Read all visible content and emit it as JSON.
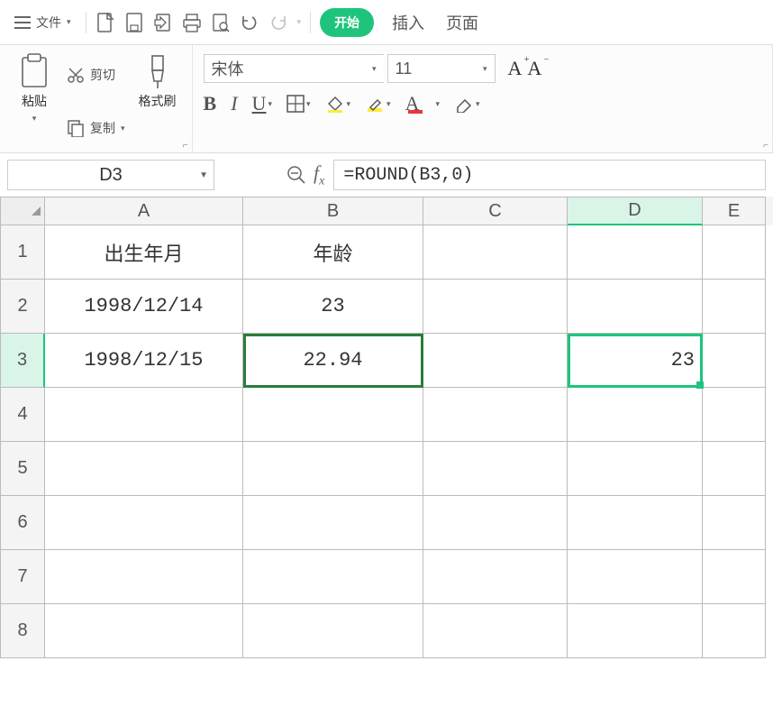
{
  "menu": {
    "file": "文件",
    "start": "开始",
    "insert": "插入",
    "pagelayout": "页面"
  },
  "ribbon": {
    "paste": "粘贴",
    "cut": "剪切",
    "copy": "复制",
    "format_brush": "格式刷",
    "font_name": "宋体",
    "font_size": "11"
  },
  "namebox": "D3",
  "formula": "=ROUND(B3,0)",
  "columns": [
    "A",
    "B",
    "C",
    "D",
    "E"
  ],
  "rows": [
    {
      "n": "1",
      "A": "出生年月",
      "B": "年龄",
      "C": "",
      "D": ""
    },
    {
      "n": "2",
      "A": "1998/12/14",
      "B": "23",
      "C": "",
      "D": ""
    },
    {
      "n": "3",
      "A": "1998/12/15",
      "B": "22.94",
      "C": "",
      "D": "23"
    },
    {
      "n": "4",
      "A": "",
      "B": "",
      "C": "",
      "D": ""
    },
    {
      "n": "5",
      "A": "",
      "B": "",
      "C": "",
      "D": ""
    },
    {
      "n": "6",
      "A": "",
      "B": "",
      "C": "",
      "D": ""
    },
    {
      "n": "7",
      "A": "",
      "B": "",
      "C": "",
      "D": ""
    },
    {
      "n": "8",
      "A": "",
      "B": "",
      "C": "",
      "D": ""
    }
  ]
}
